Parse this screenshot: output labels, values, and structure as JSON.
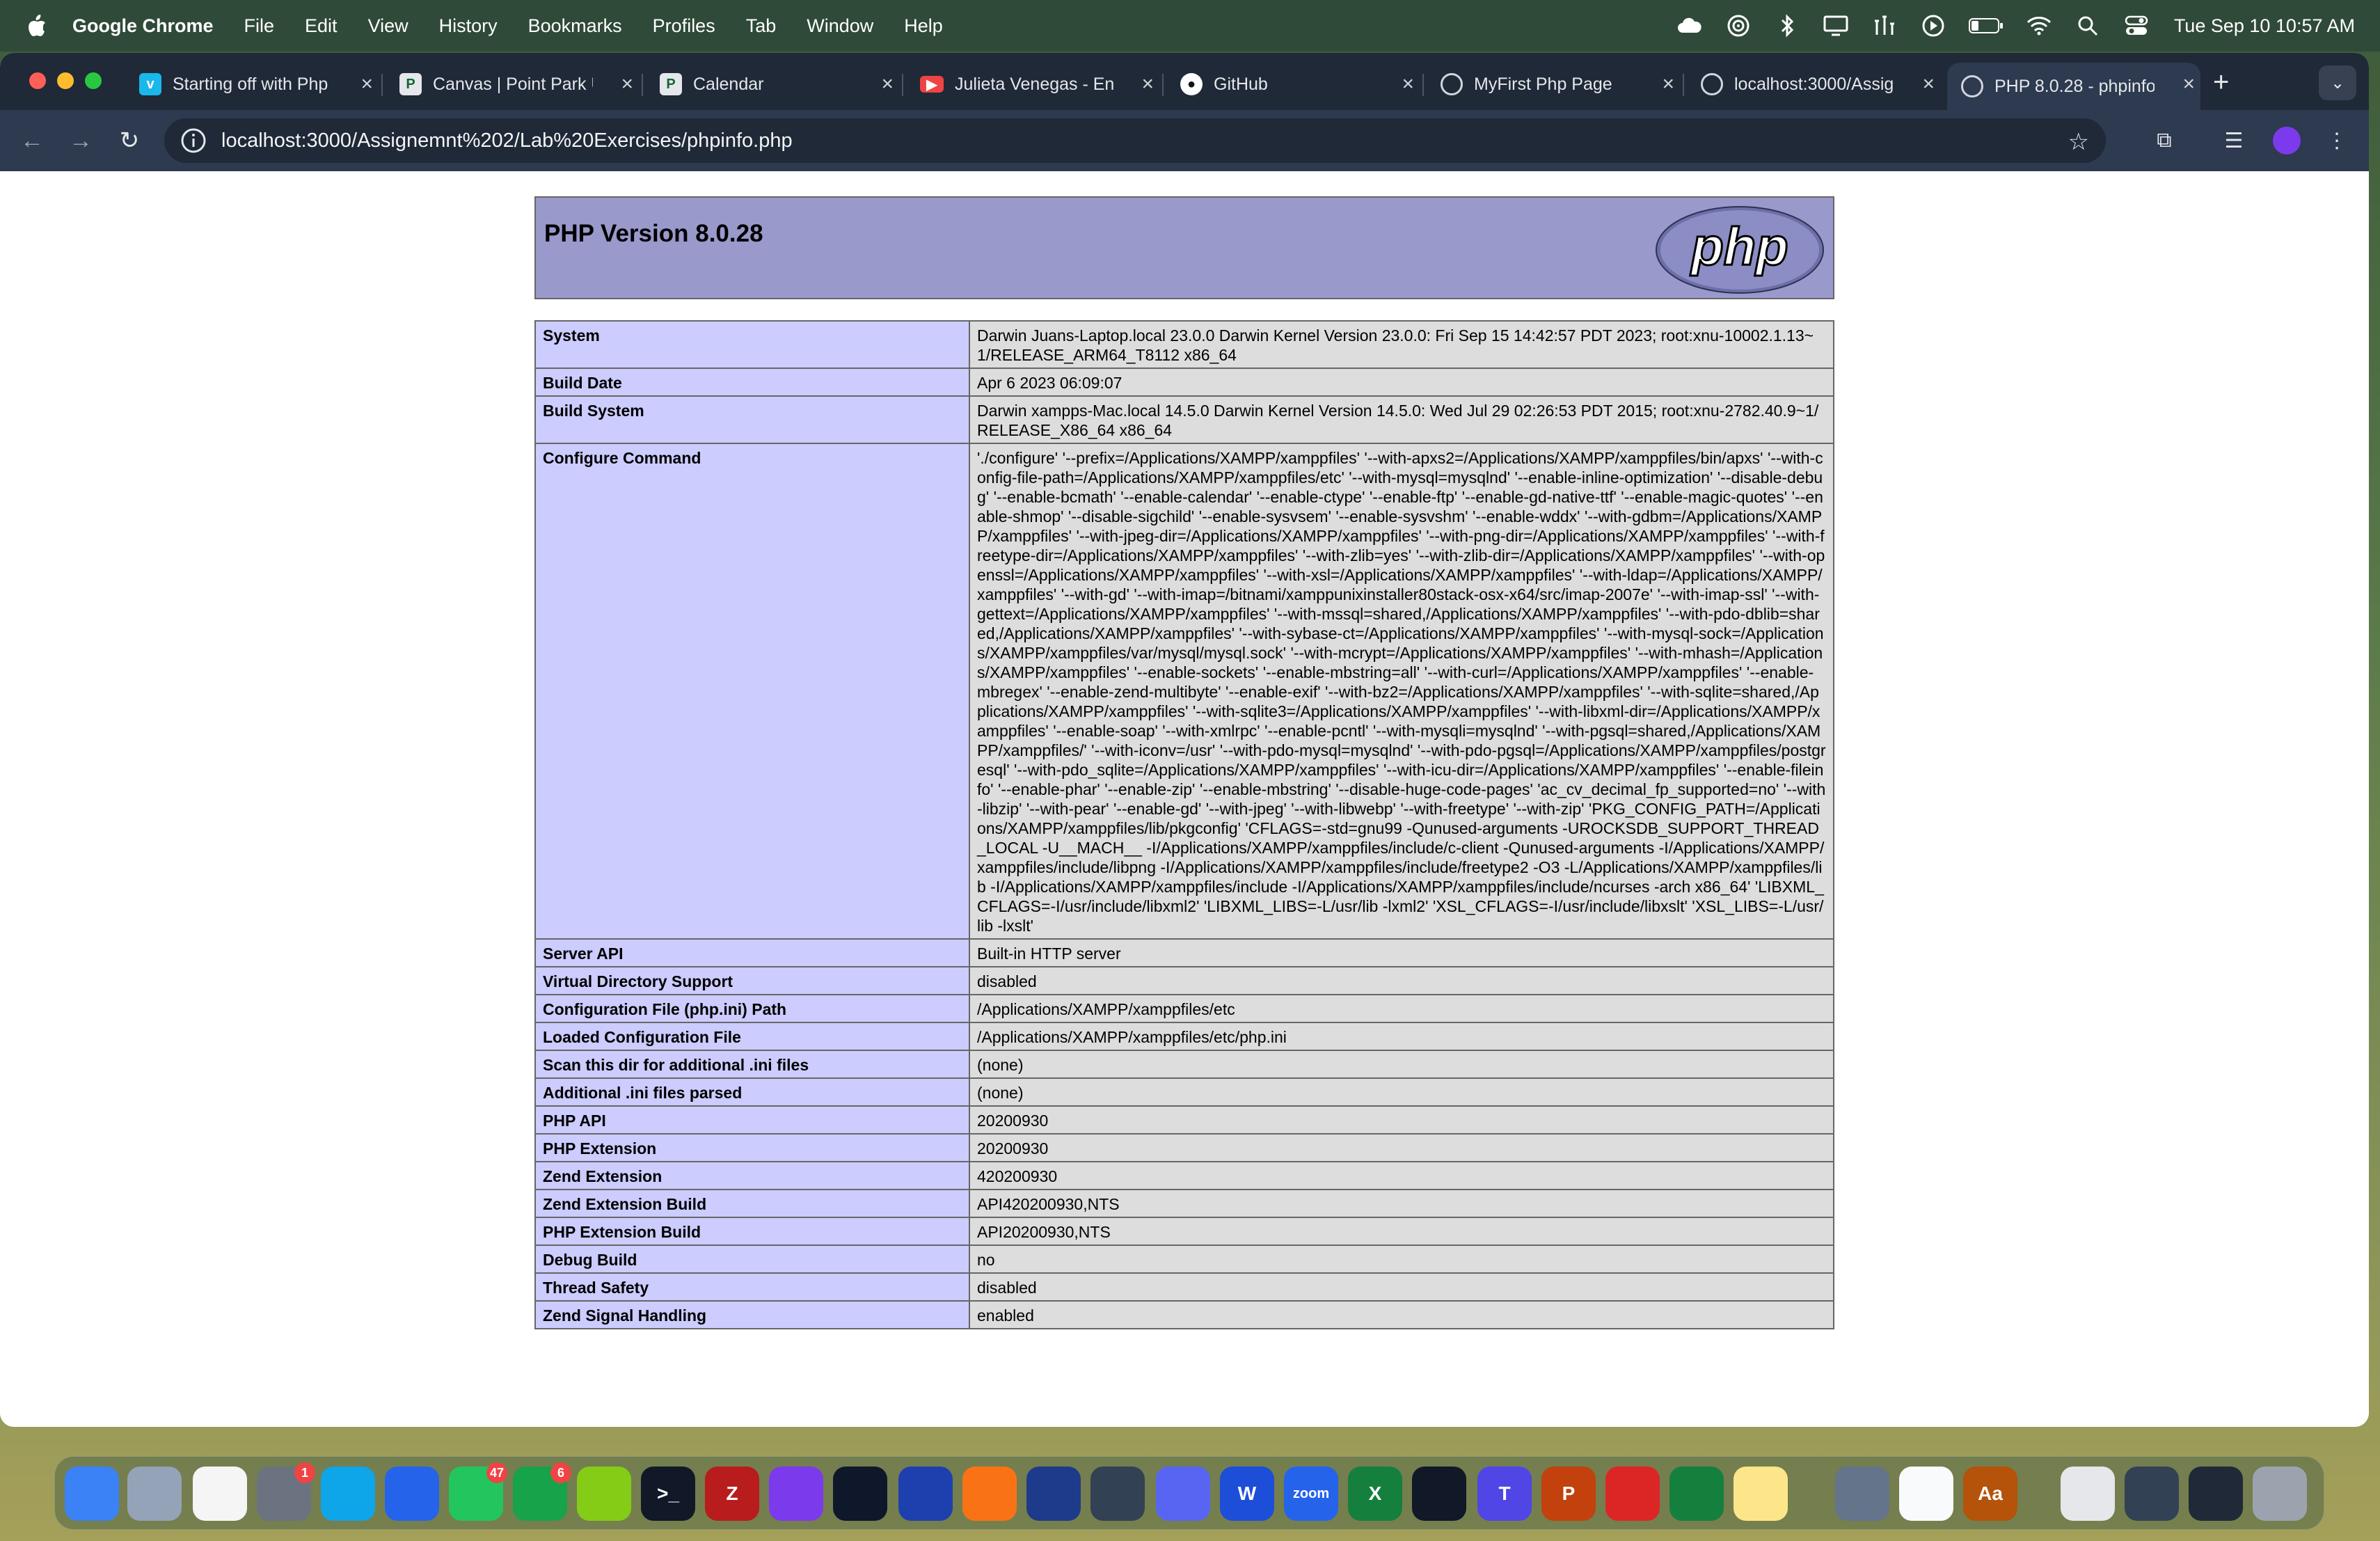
{
  "menubar": {
    "app_name": "Google Chrome",
    "items": [
      "File",
      "Edit",
      "View",
      "History",
      "Bookmarks",
      "Profiles",
      "Tab",
      "Window",
      "Help"
    ],
    "clock": "Tue Sep 10  10:57 AM"
  },
  "tabs": [
    {
      "title": "Starting off with Php",
      "icon": "vimeo-icon",
      "color": "#1ab7ea"
    },
    {
      "title": "Canvas | Point Park U",
      "icon": "canvas-icon",
      "color": "#e5e7eb"
    },
    {
      "title": "Calendar",
      "icon": "calendar-icon",
      "color": "#e5e7eb"
    },
    {
      "title": "Julieta Venegas - En",
      "icon": "youtube-icon",
      "color": "#ef4444"
    },
    {
      "title": "GitHub",
      "icon": "github-icon",
      "color": "#ffffff"
    },
    {
      "title": "MyFirst Php Page",
      "icon": "globe-icon",
      "color": "#e5e7eb"
    },
    {
      "title": "localhost:3000/Assig",
      "icon": "globe-icon",
      "color": "#e5e7eb"
    },
    {
      "title": "PHP 8.0.28 - phpinfo",
      "icon": "globe-icon",
      "color": "#e5e7eb",
      "active": true
    }
  ],
  "address_bar": {
    "url": "localhost:3000/Assignemnt%202/Lab%20Exercises/phpinfo.php"
  },
  "page": {
    "heading": "PHP Version 8.0.28",
    "logo_text": "php",
    "rows": [
      {
        "key": "System",
        "value": "Darwin Juans-Laptop.local 23.0.0 Darwin Kernel Version 23.0.0: Fri Sep 15 14:42:57 PDT 2023; root:xnu-10002.1.13~1/RELEASE_ARM64_T8112 x86_64"
      },
      {
        "key": "Build Date",
        "value": "Apr 6 2023 06:09:07"
      },
      {
        "key": "Build System",
        "value": "Darwin xampps-Mac.local 14.5.0 Darwin Kernel Version 14.5.0: Wed Jul 29 02:26:53 PDT 2015; root:xnu-2782.40.9~1/RELEASE_X86_64 x86_64"
      },
      {
        "key": "Configure Command",
        "value": "'./configure' '--prefix=/Applications/XAMPP/xamppfiles' '--with-apxs2=/Applications/XAMPP/xamppfiles/bin/apxs' '--with-config-file-path=/Applications/XAMPP/xamppfiles/etc' '--with-mysql=mysqlnd' '--enable-inline-optimization' '--disable-debug' '--enable-bcmath' '--enable-calendar' '--enable-ctype' '--enable-ftp' '--enable-gd-native-ttf' '--enable-magic-quotes' '--enable-shmop' '--disable-sigchild' '--enable-sysvsem' '--enable-sysvshm' '--enable-wddx' '--with-gdbm=/Applications/XAMPP/xamppfiles' '--with-jpeg-dir=/Applications/XAMPP/xamppfiles' '--with-png-dir=/Applications/XAMPP/xamppfiles' '--with-freetype-dir=/Applications/XAMPP/xamppfiles' '--with-zlib=yes' '--with-zlib-dir=/Applications/XAMPP/xamppfiles' '--with-openssl=/Applications/XAMPP/xamppfiles' '--with-xsl=/Applications/XAMPP/xamppfiles' '--with-ldap=/Applications/XAMPP/xamppfiles' '--with-gd' '--with-imap=/bitnami/xamppunixinstaller80stack-osx-x64/src/imap-2007e' '--with-imap-ssl' '--with-gettext=/Applications/XAMPP/xamppfiles' '--with-mssql=shared,/Applications/XAMPP/xamppfiles' '--with-pdo-dblib=shared,/Applications/XAMPP/xamppfiles' '--with-sybase-ct=/Applications/XAMPP/xamppfiles' '--with-mysql-sock=/Applications/XAMPP/xamppfiles/var/mysql/mysql.sock' '--with-mcrypt=/Applications/XAMPP/xamppfiles' '--with-mhash=/Applications/XAMPP/xamppfiles' '--enable-sockets' '--enable-mbstring=all' '--with-curl=/Applications/XAMPP/xamppfiles' '--enable-mbregex' '--enable-zend-multibyte' '--enable-exif' '--with-bz2=/Applications/XAMPP/xamppfiles' '--with-sqlite=shared,/Applications/XAMPP/xamppfiles' '--with-sqlite3=/Applications/XAMPP/xamppfiles' '--with-libxml-dir=/Applications/XAMPP/xamppfiles' '--enable-soap' '--with-xmlrpc' '--enable-pcntl' '--with-mysqli=mysqlnd' '--with-pgsql=shared,/Applications/XAMPP/xamppfiles/' '--with-iconv=/usr' '--with-pdo-mysql=mysqlnd' '--with-pdo-pgsql=/Applications/XAMPP/xamppfiles/postgresql' '--with-pdo_sqlite=/Applications/XAMPP/xamppfiles' '--with-icu-dir=/Applications/XAMPP/xamppfiles' '--enable-fileinfo' '--enable-phar' '--enable-zip' '--enable-mbstring' '--disable-huge-code-pages' 'ac_cv_decimal_fp_supported=no' '--with-libzip' '--with-pear' '--enable-gd' '--with-jpeg' '--with-libwebp' '--with-freetype' '--with-zip' 'PKG_CONFIG_PATH=/Applications/XAMPP/xamppfiles/lib/pkgconfig' 'CFLAGS=-std=gnu99 -Qunused-arguments -UROCKSDB_SUPPORT_THREAD_LOCAL -U__MACH__ -I/Applications/XAMPP/xamppfiles/include/c-client -Qunused-arguments -I/Applications/XAMPP/xamppfiles/include/libpng -I/Applications/XAMPP/xamppfiles/include/freetype2 -O3 -L/Applications/XAMPP/xamppfiles/lib -I/Applications/XAMPP/xamppfiles/include -I/Applications/XAMPP/xamppfiles/include/ncurses -arch x86_64' 'LIBXML_CFLAGS=-I/usr/include/libxml2' 'LIBXML_LIBS=-L/usr/lib -lxml2' 'XSL_CFLAGS=-I/usr/include/libxslt' 'XSL_LIBS=-L/usr/lib -lxslt'"
      },
      {
        "key": "Server API",
        "value": "Built-in HTTP server"
      },
      {
        "key": "Virtual Directory Support",
        "value": "disabled"
      },
      {
        "key": "Configuration File (php.ini) Path",
        "value": "/Applications/XAMPP/xamppfiles/etc"
      },
      {
        "key": "Loaded Configuration File",
        "value": "/Applications/XAMPP/xamppfiles/etc/php.ini"
      },
      {
        "key": "Scan this dir for additional .ini files",
        "value": "(none)"
      },
      {
        "key": "Additional .ini files parsed",
        "value": "(none)"
      },
      {
        "key": "PHP API",
        "value": "20200930"
      },
      {
        "key": "PHP Extension",
        "value": "20200930"
      },
      {
        "key": "Zend Extension",
        "value": "420200930"
      },
      {
        "key": "Zend Extension Build",
        "value": "API420200930,NTS"
      },
      {
        "key": "PHP Extension Build",
        "value": "API20200930,NTS"
      },
      {
        "key": "Debug Build",
        "value": "no"
      },
      {
        "key": "Thread Safety",
        "value": "disabled"
      },
      {
        "key": "Zend Signal Handling",
        "value": "enabled"
      }
    ]
  },
  "dock": {
    "apps": [
      {
        "name": "finder-icon",
        "color": "#3b82f6",
        "label": ""
      },
      {
        "name": "launchpad-icon",
        "color": "#94a3b8",
        "label": ""
      },
      {
        "name": "chrome-icon",
        "color": "#f5f5f5",
        "label": ""
      },
      {
        "name": "system-settings-icon",
        "color": "#6b7280",
        "label": "",
        "badge": "1"
      },
      {
        "name": "safari-icon",
        "color": "#0ea5e9",
        "label": ""
      },
      {
        "name": "app-store-icon",
        "color": "#2563eb",
        "label": ""
      },
      {
        "name": "messages-icon",
        "color": "#22c55e",
        "label": "",
        "badge": "47"
      },
      {
        "name": "facetime-icon",
        "color": "#16a34a",
        "label": "",
        "badge": "6"
      },
      {
        "name": "maps-icon",
        "color": "#84cc16",
        "label": ""
      },
      {
        "name": "terminal-icon",
        "color": "#111827",
        "label": ">_"
      },
      {
        "name": "filezilla-icon",
        "color": "#b91c1c",
        "label": "Z"
      },
      {
        "name": "github-desktop-icon",
        "color": "#7c3aed",
        "label": ""
      },
      {
        "name": "vscode-icon",
        "color": "#0f172a",
        "label": ""
      },
      {
        "name": "virtualbox-icon",
        "color": "#1e40af",
        "label": ""
      },
      {
        "name": "pencil-app-icon",
        "color": "#f97316",
        "label": ""
      },
      {
        "name": "mysql-workbench-icon",
        "color": "#1e3a8a",
        "label": ""
      },
      {
        "name": "pgadmin-icon",
        "color": "#334155",
        "label": ""
      },
      {
        "name": "discord-icon",
        "color": "#5865f2",
        "label": ""
      },
      {
        "name": "word-icon",
        "color": "#1d4ed8",
        "label": "W"
      },
      {
        "name": "zoom-icon",
        "color": "#2563eb",
        "label": "zoom"
      },
      {
        "name": "excel-icon",
        "color": "#15803d",
        "label": "X"
      },
      {
        "name": "spotify-icon",
        "color": "#111827",
        "label": ""
      },
      {
        "name": "teams-icon",
        "color": "#4f46e5",
        "label": "T"
      },
      {
        "name": "powerpoint-icon",
        "color": "#c2410c",
        "label": "P"
      },
      {
        "name": "mcafee-icon",
        "color": "#dc2626",
        "label": ""
      },
      {
        "name": "minecraft-icon",
        "color": "#15803d",
        "label": ""
      },
      {
        "name": "notes-icon",
        "color": "#fde68a",
        "label": ""
      },
      {
        "name": "preview-icon",
        "color": "#64748b",
        "label": ""
      },
      {
        "name": "clock-icon",
        "color": "#f8fafc",
        "label": ""
      },
      {
        "name": "dictionary-icon",
        "color": "#b45309",
        "label": "Aa"
      },
      {
        "name": "document-icon",
        "color": "#e5e7eb",
        "label": ""
      },
      {
        "name": "downloads-stack-icon",
        "color": "#334155",
        "label": ""
      },
      {
        "name": "screen-stack-icon",
        "color": "#1f2937",
        "label": ""
      },
      {
        "name": "trash-icon",
        "color": "#9ca3af",
        "label": ""
      }
    ]
  }
}
